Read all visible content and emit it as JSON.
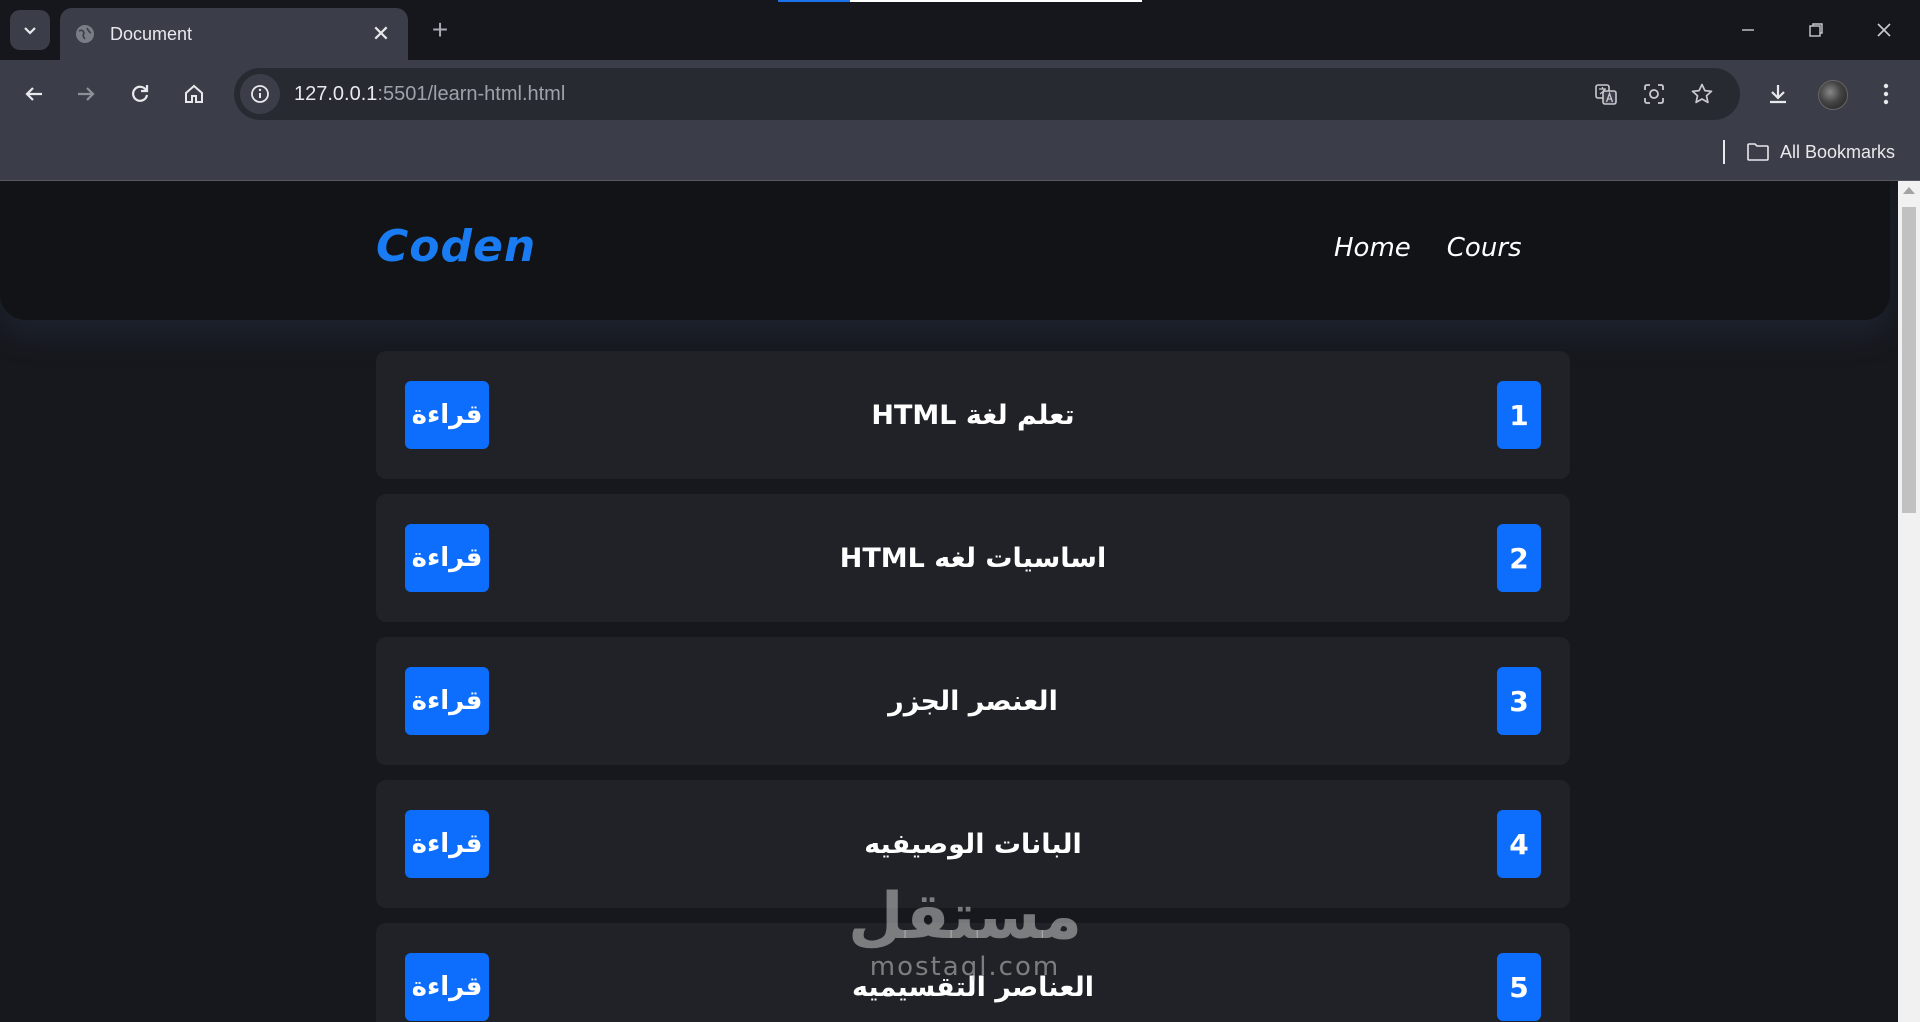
{
  "browser": {
    "tab_title": "Document",
    "new_tab_symbol": "+",
    "close_symbol": "✕",
    "url_host": "127.0.0.1",
    "url_path": ":5501/learn-html.html",
    "bookmarks_label": "All Bookmarks",
    "accent": "#1a73e8"
  },
  "site": {
    "logo": "Coden",
    "nav": [
      "Home",
      "Cours"
    ],
    "accent": "#0d6efd"
  },
  "lessons": [
    {
      "number": "1",
      "title": "تعلم لغة HTML",
      "button": "قراءة"
    },
    {
      "number": "2",
      "title": "اساسيات لغه HTML",
      "button": "قراءة"
    },
    {
      "number": "3",
      "title": "العنصر الجزر",
      "button": "قراءة"
    },
    {
      "number": "4",
      "title": "البانات الوصيفيه",
      "button": "قراءة"
    },
    {
      "number": "5",
      "title": "العناصر التقسيميه",
      "button": "قراءة"
    }
  ],
  "watermark": {
    "arabic": "مستقل",
    "latin": "mostaql.com"
  }
}
